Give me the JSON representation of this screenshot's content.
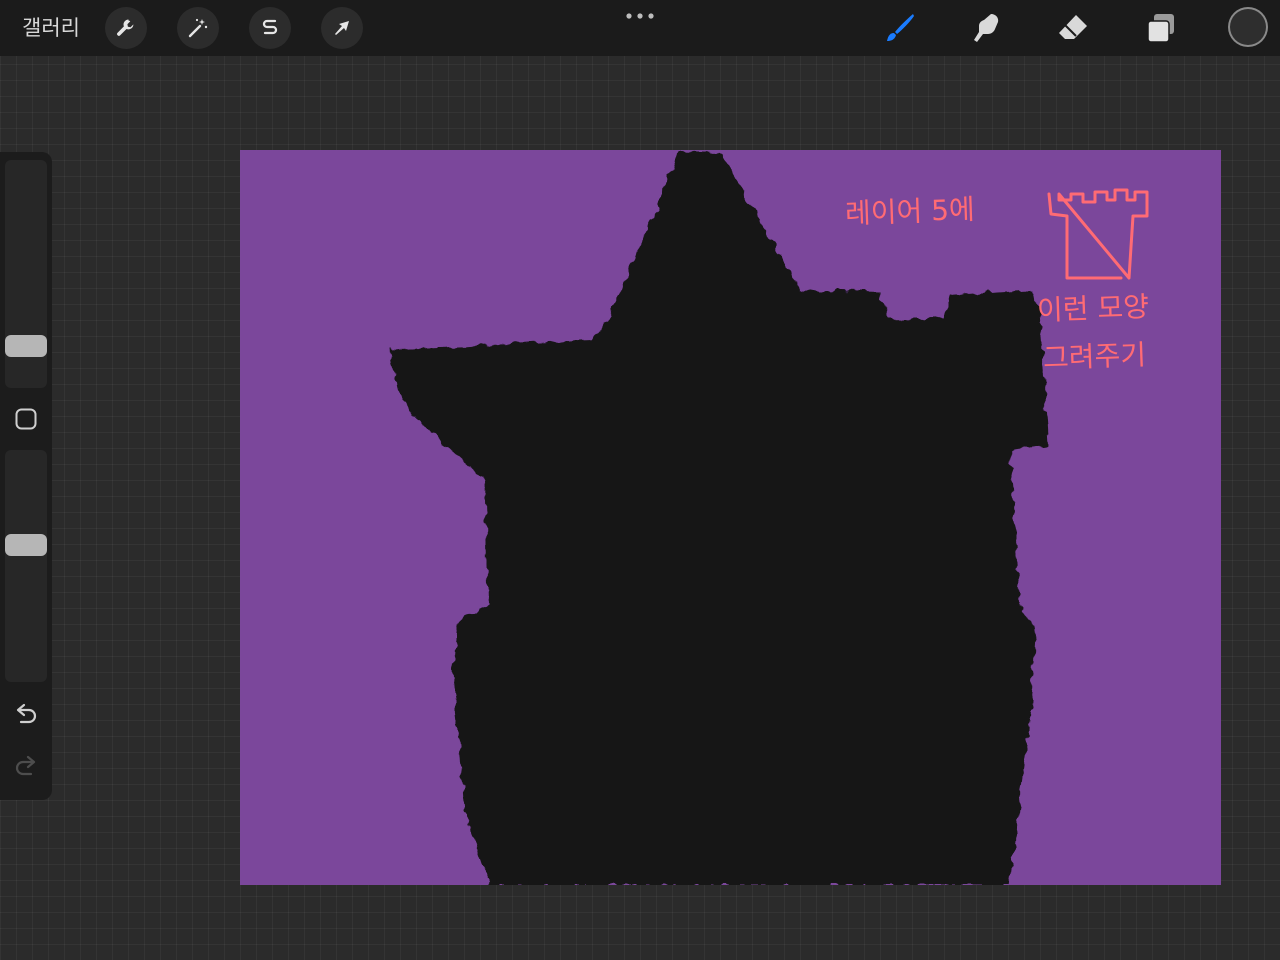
{
  "topbar": {
    "gallery_label": "갤러리",
    "left_tools": [
      {
        "name": "actions",
        "icon": "wrench-icon"
      },
      {
        "name": "adjustments",
        "icon": "magic-wand-icon"
      },
      {
        "name": "selection",
        "icon": "selection-s-icon"
      },
      {
        "name": "transform",
        "icon": "arrow-cursor-icon"
      }
    ],
    "more_icon": "ellipsis-icon",
    "right_tools": [
      {
        "name": "brush",
        "icon": "brush-icon",
        "active": true
      },
      {
        "name": "smudge",
        "icon": "smudge-finger-icon",
        "active": false
      },
      {
        "name": "eraser",
        "icon": "eraser-icon",
        "active": false
      },
      {
        "name": "layers",
        "icon": "layers-icon",
        "active": false
      }
    ],
    "current_color": "#2e2e2e"
  },
  "sidebar": {
    "brush_size_level": 0.15,
    "opacity_level": 0.6,
    "modify_icon": "square-outline-icon",
    "undo_icon": "undo-icon",
    "redo_icon": "redo-icon",
    "redo_enabled": false
  },
  "canvas": {
    "background_color": "#7b479b",
    "shape_color": "#161218",
    "note_color": "#ff6b74",
    "notes": {
      "line1": "레이어 5에",
      "line2": "이런 모양",
      "line3": "그려주기"
    }
  }
}
